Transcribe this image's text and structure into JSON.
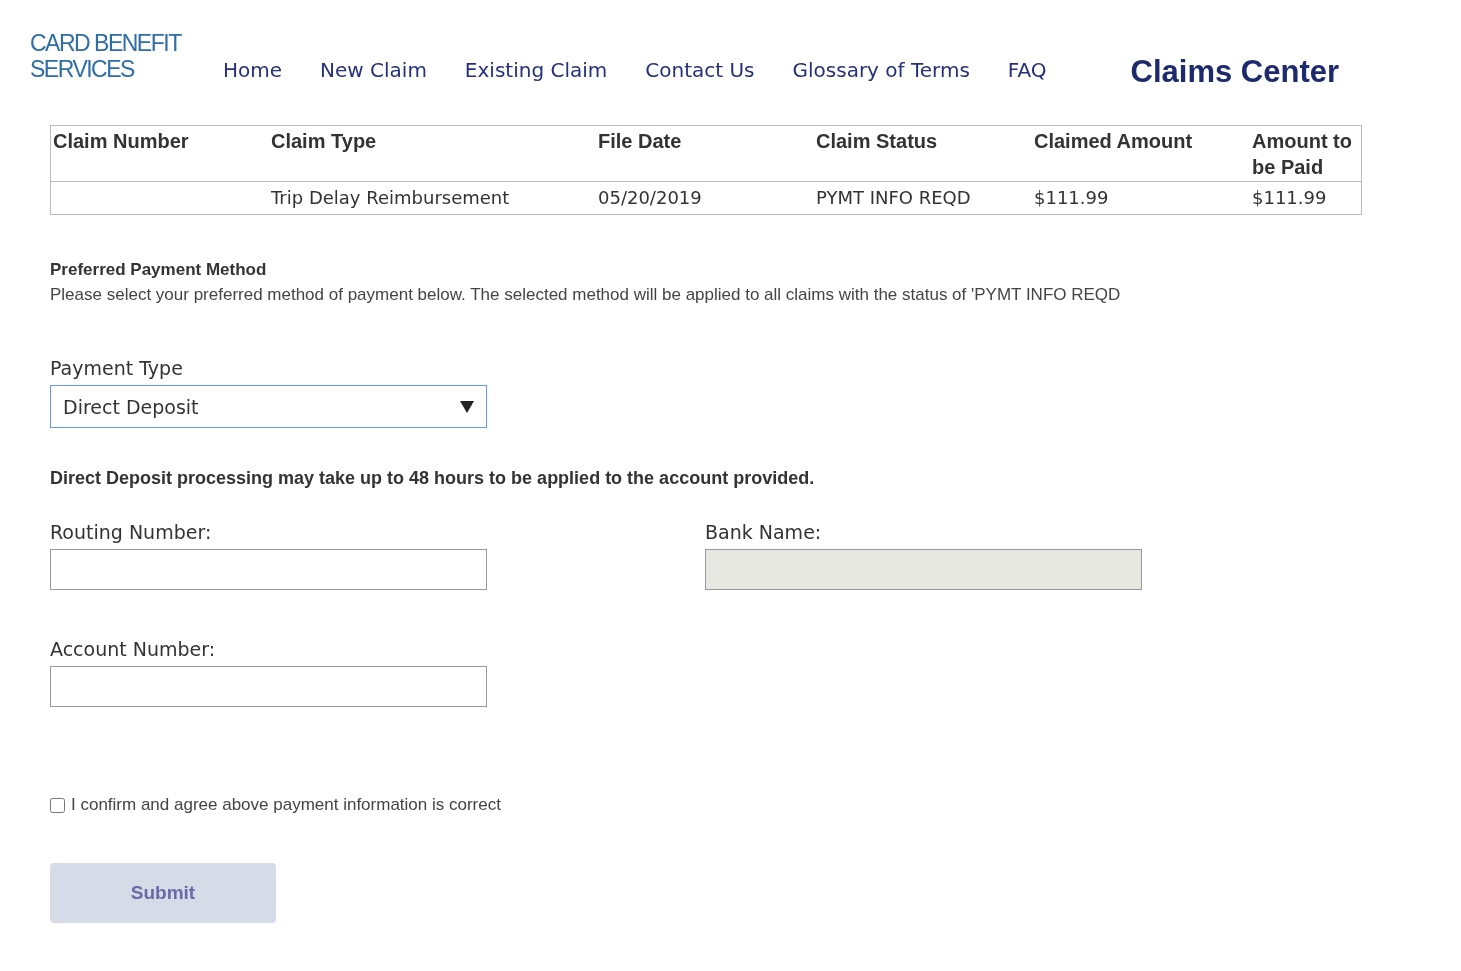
{
  "logo": {
    "lines": [
      "CARD BENEFIT",
      "SERVICES"
    ]
  },
  "nav": {
    "items": [
      "Home",
      "New Claim",
      "Existing Claim",
      "Contact Us",
      "Glossary of Terms",
      "FAQ"
    ],
    "title": "Claims Center"
  },
  "table": {
    "columns": [
      "Claim Number",
      "Claim Type",
      "File Date",
      "Claim Status",
      "Claimed Amount",
      "Amount to be Paid"
    ],
    "rows": [
      [
        "",
        "Trip Delay Reimbursement",
        "05/20/2019",
        "PYMT INFO REQD",
        "$111.99",
        "$111.99"
      ]
    ]
  },
  "payment": {
    "heading": "Preferred Payment Method",
    "description": "Please select your preferred method of payment below. The selected method will be applied to all claims with the status of 'PYMT INFO REQD",
    "type_label": "Payment Type",
    "type_value": "Direct Deposit",
    "notice": "Direct Deposit processing may take up to 48 hours to be applied to the account provided."
  },
  "fields": [
    {
      "label": "Routing Number:",
      "disabled": false
    },
    {
      "label": "Bank Name:",
      "disabled": true
    },
    {
      "label": "Account Number:",
      "disabled": false
    }
  ],
  "confirm": {
    "label": "I confirm and agree above payment information is correct",
    "checked": false
  },
  "submit": {
    "label": "Submit",
    "disabled": true
  }
}
